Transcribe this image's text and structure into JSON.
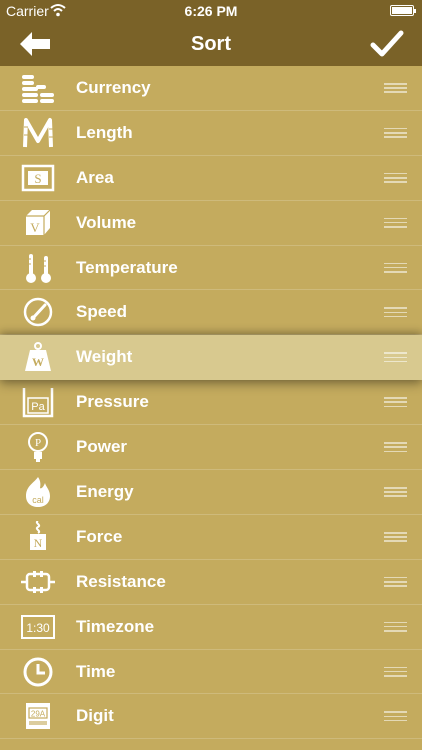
{
  "status_bar": {
    "carrier": "Carrier",
    "time": "6:26 PM"
  },
  "nav": {
    "title": "Sort",
    "back_icon": "arrow-left-icon",
    "done_icon": "checkmark-icon"
  },
  "items": [
    {
      "label": "Currency",
      "icon": "coins-icon"
    },
    {
      "label": "Length",
      "icon": "folding-ruler-icon"
    },
    {
      "label": "Area",
      "icon": "area-icon",
      "glyph": "S"
    },
    {
      "label": "Volume",
      "icon": "cube-icon",
      "glyph": "V"
    },
    {
      "label": "Temperature",
      "icon": "thermometer-icon"
    },
    {
      "label": "Speed",
      "icon": "speedometer-icon"
    },
    {
      "label": "Weight",
      "icon": "weight-icon",
      "glyph": "W"
    },
    {
      "label": "Pressure",
      "icon": "pressure-gauge-icon",
      "glyph": "Pa"
    },
    {
      "label": "Power",
      "icon": "lightbulb-icon",
      "glyph": "P"
    },
    {
      "label": "Energy",
      "icon": "flame-icon",
      "glyph": "cal"
    },
    {
      "label": "Force",
      "icon": "spring-scale-icon",
      "glyph": "N"
    },
    {
      "label": "Resistance",
      "icon": "resistor-icon"
    },
    {
      "label": "Timezone",
      "icon": "digital-clock-icon",
      "glyph": "1:30"
    },
    {
      "label": "Time",
      "icon": "clock-icon"
    },
    {
      "label": "Digit",
      "icon": "digit-card-icon",
      "glyph": "29A"
    }
  ],
  "dragging_item": "Weight"
}
